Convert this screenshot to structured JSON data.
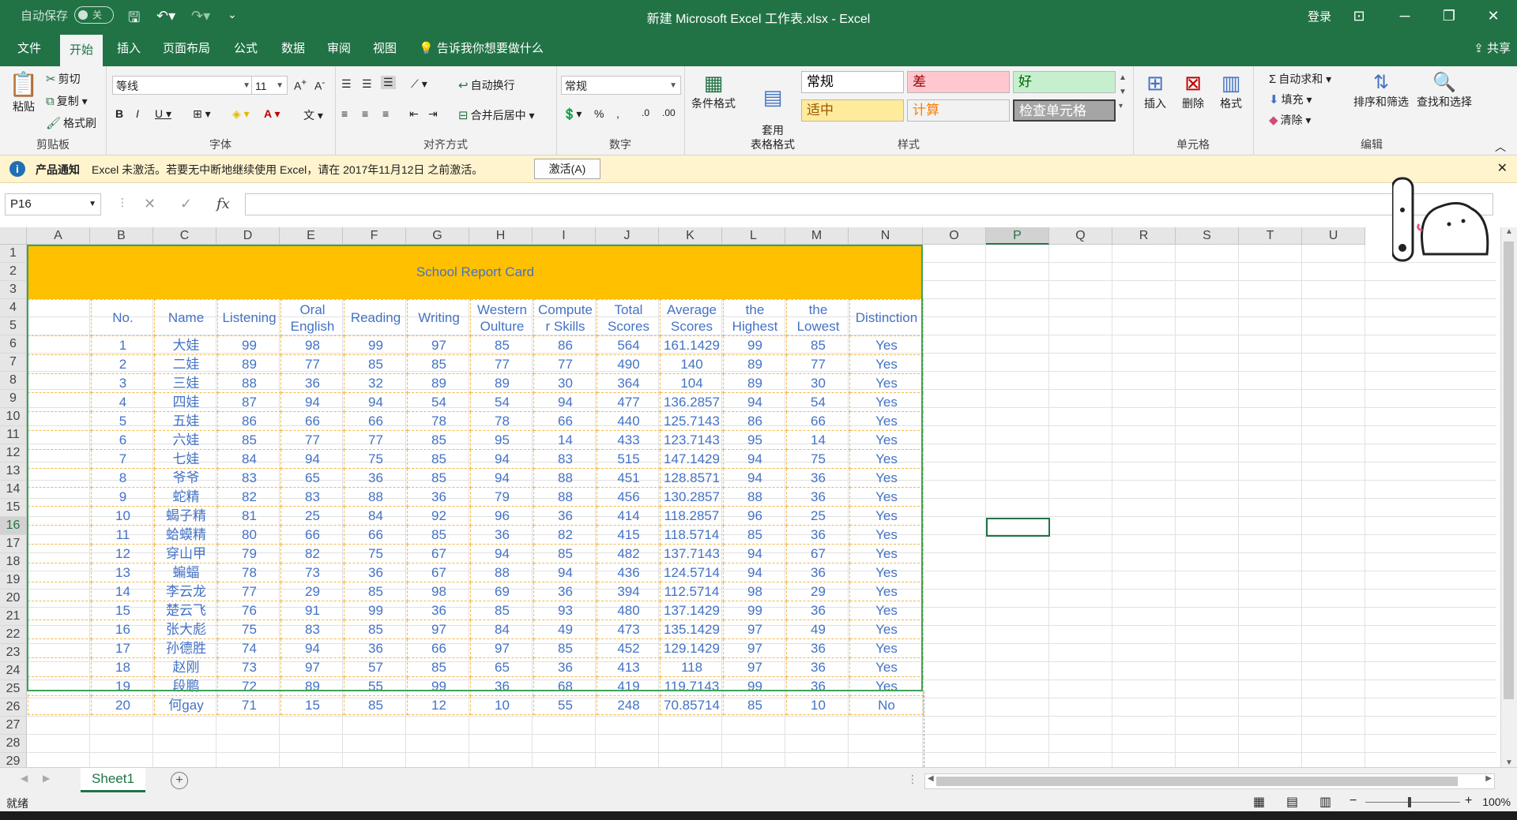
{
  "titlebar": {
    "autosave_label": "自动保存",
    "autosave_state": "关",
    "title": "新建 Microsoft Excel 工作表.xlsx  -  Excel",
    "login": "登录"
  },
  "tabs": [
    "文件",
    "开始",
    "插入",
    "页面布局",
    "公式",
    "数据",
    "审阅",
    "视图"
  ],
  "tell_me": "告诉我你想要做什么",
  "share": "共享",
  "ribbon": {
    "clipboard": {
      "label": "剪贴板",
      "paste": "粘贴",
      "cut": "剪切",
      "copy": "复制",
      "format_painter": "格式刷"
    },
    "font": {
      "label": "字体",
      "family": "等线",
      "size": "11"
    },
    "alignment": {
      "label": "对齐方式",
      "wrap": "自动换行",
      "merge": "合并后居中"
    },
    "number": {
      "label": "数字",
      "format": "常规"
    },
    "styles": {
      "label": "样式",
      "cond_format": "条件格式",
      "table_format": "套用\n表格格式",
      "normal": "常规",
      "bad": "差",
      "good": "好",
      "neutral": "适中",
      "calc": "计算",
      "check": "检查单元格"
    },
    "cells": {
      "label": "单元格",
      "insert": "插入",
      "delete": "删除",
      "format": "格式"
    },
    "editing": {
      "label": "编辑",
      "autosum": "自动求和",
      "fill": "填充",
      "clear": "清除",
      "sort": "排序和筛选",
      "find": "查找和选择"
    }
  },
  "notice": {
    "title": "产品通知",
    "text": "Excel 未激活。若要无中断地继续使用 Excel，请在 2017年11月12日 之前激活。",
    "button": "激活(A)"
  },
  "formula_bar": {
    "name_box": "P16",
    "fx": "fx"
  },
  "columns": [
    "A",
    "B",
    "C",
    "D",
    "E",
    "F",
    "G",
    "H",
    "I",
    "J",
    "K",
    "L",
    "M",
    "N",
    "O",
    "P",
    "Q",
    "R",
    "S",
    "T",
    "U"
  ],
  "selected_column": "P",
  "selected_row": 16,
  "rows": [
    1,
    2,
    3,
    4,
    5,
    6,
    7,
    8,
    9,
    10,
    11,
    12,
    13,
    14,
    15,
    16,
    17,
    18,
    19,
    20,
    21,
    22,
    23,
    24,
    25,
    26,
    27,
    28,
    29
  ],
  "sheet": {
    "banner": "School Report Card",
    "headers": [
      "No.",
      "Name",
      "Listening",
      "Oral English",
      "Reading",
      "Writing",
      "Western Oulture",
      "Compute r Skills",
      "Total Scores",
      "Average Scores",
      "the Highest",
      "the Lowest",
      "Distinction"
    ],
    "data": [
      [
        "1",
        "大娃",
        "99",
        "98",
        "99",
        "97",
        "85",
        "86",
        "564",
        "161.1429",
        "99",
        "85",
        "Yes"
      ],
      [
        "2",
        "二娃",
        "89",
        "77",
        "85",
        "85",
        "77",
        "77",
        "490",
        "140",
        "89",
        "77",
        "Yes"
      ],
      [
        "3",
        "三娃",
        "88",
        "36",
        "32",
        "89",
        "89",
        "30",
        "364",
        "104",
        "89",
        "30",
        "Yes"
      ],
      [
        "4",
        "四娃",
        "87",
        "94",
        "94",
        "54",
        "54",
        "94",
        "477",
        "136.2857",
        "94",
        "54",
        "Yes"
      ],
      [
        "5",
        "五娃",
        "86",
        "66",
        "66",
        "78",
        "78",
        "66",
        "440",
        "125.7143",
        "86",
        "66",
        "Yes"
      ],
      [
        "6",
        "六娃",
        "85",
        "77",
        "77",
        "85",
        "95",
        "14",
        "433",
        "123.7143",
        "95",
        "14",
        "Yes"
      ],
      [
        "7",
        "七娃",
        "84",
        "94",
        "75",
        "85",
        "94",
        "83",
        "515",
        "147.1429",
        "94",
        "75",
        "Yes"
      ],
      [
        "8",
        "爷爷",
        "83",
        "65",
        "36",
        "85",
        "94",
        "88",
        "451",
        "128.8571",
        "94",
        "36",
        "Yes"
      ],
      [
        "9",
        "蛇精",
        "82",
        "83",
        "88",
        "36",
        "79",
        "88",
        "456",
        "130.2857",
        "88",
        "36",
        "Yes"
      ],
      [
        "10",
        "蝎子精",
        "81",
        "25",
        "84",
        "92",
        "96",
        "36",
        "414",
        "118.2857",
        "96",
        "25",
        "Yes"
      ],
      [
        "11",
        "蛤蟆精",
        "80",
        "66",
        "66",
        "85",
        "36",
        "82",
        "415",
        "118.5714",
        "85",
        "36",
        "Yes"
      ],
      [
        "12",
        "穿山甲",
        "79",
        "82",
        "75",
        "67",
        "94",
        "85",
        "482",
        "137.7143",
        "94",
        "67",
        "Yes"
      ],
      [
        "13",
        "蝙蝠",
        "78",
        "73",
        "36",
        "67",
        "88",
        "94",
        "436",
        "124.5714",
        "94",
        "36",
        "Yes"
      ],
      [
        "14",
        "李云龙",
        "77",
        "29",
        "85",
        "98",
        "69",
        "36",
        "394",
        "112.5714",
        "98",
        "29",
        "Yes"
      ],
      [
        "15",
        "楚云飞",
        "76",
        "91",
        "99",
        "36",
        "85",
        "93",
        "480",
        "137.1429",
        "99",
        "36",
        "Yes"
      ],
      [
        "16",
        "张大彪",
        "75",
        "83",
        "85",
        "97",
        "84",
        "49",
        "473",
        "135.1429",
        "97",
        "49",
        "Yes"
      ],
      [
        "17",
        "孙德胜",
        "74",
        "94",
        "36",
        "66",
        "97",
        "85",
        "452",
        "129.1429",
        "97",
        "36",
        "Yes"
      ],
      [
        "18",
        "赵刚",
        "73",
        "97",
        "57",
        "85",
        "65",
        "36",
        "413",
        "118",
        "97",
        "36",
        "Yes"
      ],
      [
        "19",
        "段鹏",
        "72",
        "89",
        "55",
        "99",
        "36",
        "68",
        "419",
        "119.7143",
        "99",
        "36",
        "Yes"
      ],
      [
        "20",
        "何gay",
        "71",
        "15",
        "85",
        "12",
        "10",
        "55",
        "248",
        "70.85714",
        "85",
        "10",
        "No"
      ]
    ]
  },
  "sheet_tab": "Sheet1",
  "status": {
    "ready": "就绪",
    "zoom": "100%"
  },
  "colors": {
    "accent": "#217346",
    "banner": "#ffc000",
    "text_blue": "#4472c4",
    "border_orange": "#f2b84b"
  }
}
